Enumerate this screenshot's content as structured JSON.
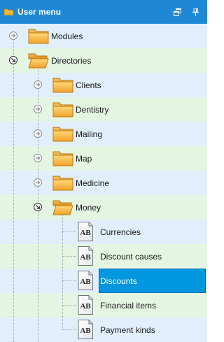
{
  "panel": {
    "title": "User menu",
    "title_icon": "folder-icon",
    "restore_icon": "restore-window-icon",
    "pin_icon": "pin-icon",
    "accent_color": "#1e87d6"
  },
  "tree": {
    "modules": "Modules",
    "directories": "Directories",
    "clients": "Clients",
    "dentistry": "Dentistry",
    "mailing": "Mailing",
    "map": "Map",
    "medicine": "Medicine",
    "money": "Money",
    "currencies": "Currencies",
    "discount_causes": "Discount causes",
    "discounts": "Discounts",
    "financial_items": "Financial items",
    "payment_kinds": "Payment kinds",
    "doc_icon_text": "AB",
    "selected_item": "Discounts",
    "selected_color": "#0096e0"
  }
}
